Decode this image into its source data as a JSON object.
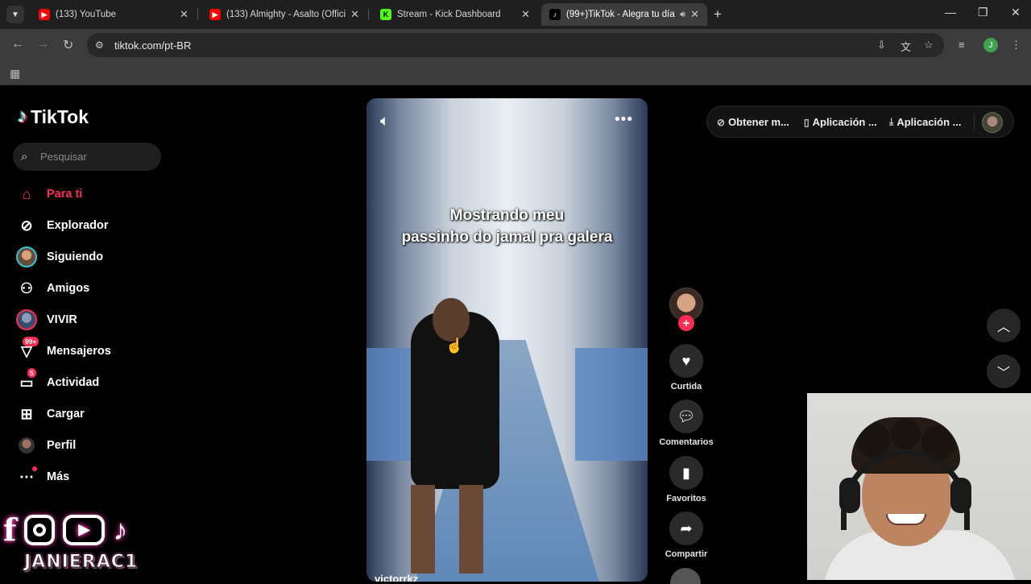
{
  "browser": {
    "tabs": [
      {
        "title": "(133) YouTube",
        "icon": "youtube-icon",
        "active": false
      },
      {
        "title": "(133) Almighty - Asalto (Official",
        "icon": "youtube-icon",
        "active": false
      },
      {
        "title": "Stream - Kick Dashboard",
        "icon": "kick-icon",
        "active": false
      },
      {
        "title": "(99+)TikTok - Alegra tu día",
        "icon": "tiktok-icon",
        "active": true
      }
    ],
    "url": "tiktok.com/pt-BR",
    "profile_initial": "J"
  },
  "tiktok": {
    "logo_text": "TikTok",
    "search_placeholder": "Pesquisar",
    "nav": [
      {
        "label": "Para ti",
        "icon": "home-icon",
        "active": true
      },
      {
        "label": "Explorador",
        "icon": "compass-icon"
      },
      {
        "label": "Siguiendo",
        "icon": "following-avatar-icon"
      },
      {
        "label": "Amigos",
        "icon": "friends-icon"
      },
      {
        "label": "VIVIR",
        "icon": "live-avatar-icon"
      },
      {
        "label": "Mensajeros",
        "icon": "messages-icon",
        "badge": "99+"
      },
      {
        "label": "Actividad",
        "icon": "activity-icon",
        "badge": "5"
      },
      {
        "label": "Cargar",
        "icon": "upload-icon"
      },
      {
        "label": "Perfil",
        "icon": "profile-avatar-icon"
      },
      {
        "label": "Más",
        "icon": "more-icon"
      }
    ],
    "video": {
      "caption_line1": "Mostrando meu",
      "caption_line2": "passinho do jamal pra galera",
      "author": "victorrkz"
    },
    "actions": [
      {
        "label": "Curtida",
        "icon": "heart-icon"
      },
      {
        "label": "Comentarios",
        "icon": "comment-icon"
      },
      {
        "label": "Favoritos",
        "icon": "bookmark-icon"
      },
      {
        "label": "Compartir",
        "icon": "share-icon"
      }
    ],
    "topbar": {
      "item1": "Obtener m...",
      "item2": "Aplicación ...",
      "item3": "Aplicación ..."
    }
  },
  "overlay": {
    "streamer_handle": "JANIERAC1"
  },
  "colors": {
    "tiktok_red": "#fe2c55",
    "tiktok_cyan": "#25f4ee",
    "chrome_dark": "#1f1f1f",
    "chrome_toolbar": "#3c3c3c"
  }
}
